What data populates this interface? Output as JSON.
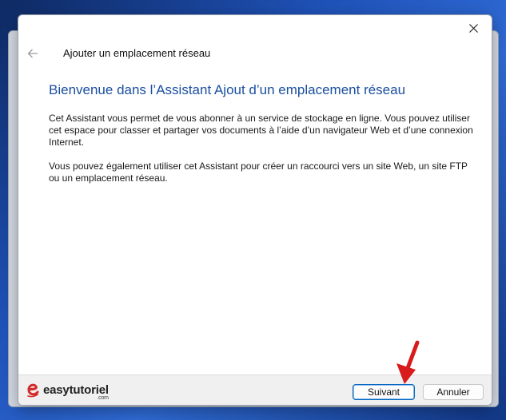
{
  "dialog": {
    "title": "Ajouter un emplacement réseau",
    "heading": "Bienvenue dans l’Assistant Ajout d’un emplacement réseau",
    "paragraph1": "Cet Assistant vous permet de vous abonner à un service de stockage en ligne. Vous pouvez utiliser cet espace pour classer et partager vos documents à l’aide d’un navigateur Web et d’une connexion Internet.",
    "paragraph2": "Vous pouvez également utiliser cet Assistant pour créer un raccourci vers un site Web, un site FTP ou un emplacement réseau."
  },
  "footer": {
    "logo_text": "easytutoriel",
    "logo_suffix": ".com",
    "next_label": "Suivant",
    "cancel_label": "Annuler"
  },
  "icons": {
    "close": "close-icon",
    "back": "back-arrow-icon",
    "logo": "easytutoriel-logo-icon",
    "annotation": "red-arrow-annotation"
  },
  "colors": {
    "heading": "#1a4fa0",
    "accent_button_border": "#0067c0",
    "annotation_arrow": "#d81b1b",
    "logo_red": "#d42a2a"
  }
}
